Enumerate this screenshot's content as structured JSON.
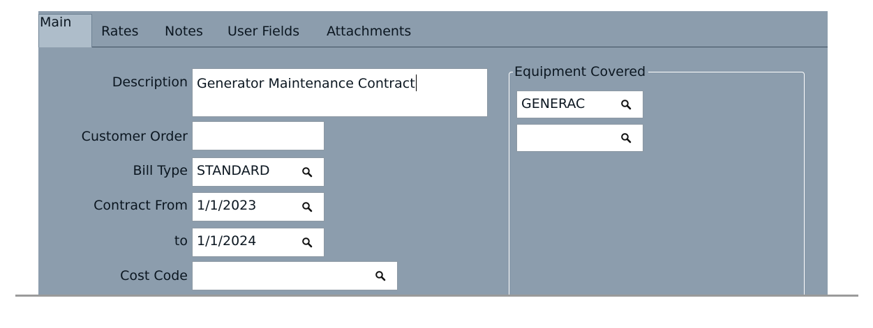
{
  "tabs": [
    {
      "label": "Main",
      "active": true
    },
    {
      "label": "Rates",
      "active": false
    },
    {
      "label": "Notes",
      "active": false
    },
    {
      "label": "User Fields",
      "active": false
    },
    {
      "label": "Attachments",
      "active": false
    }
  ],
  "form": {
    "description_label": "Description",
    "description_value": "Generator Maintenance Contract",
    "customer_order_label": "Customer Order",
    "customer_order_value": "",
    "bill_type_label": "Bill Type",
    "bill_type_value": "STANDARD",
    "contract_from_label": "Contract From",
    "contract_from_value": "1/1/2023",
    "contract_to_label": "to",
    "contract_to_value": "1/1/2024",
    "cost_code_label": "Cost Code",
    "cost_code_value": ""
  },
  "equipment": {
    "title": "Equipment Covered",
    "items": [
      {
        "value": "GENERAC"
      },
      {
        "value": ""
      }
    ]
  },
  "icons": {
    "lookup": "magnifier-icon"
  },
  "colors": {
    "panel_background": "#8c9dad",
    "active_tab": "#aebdca",
    "field_background": "#ffffff"
  }
}
